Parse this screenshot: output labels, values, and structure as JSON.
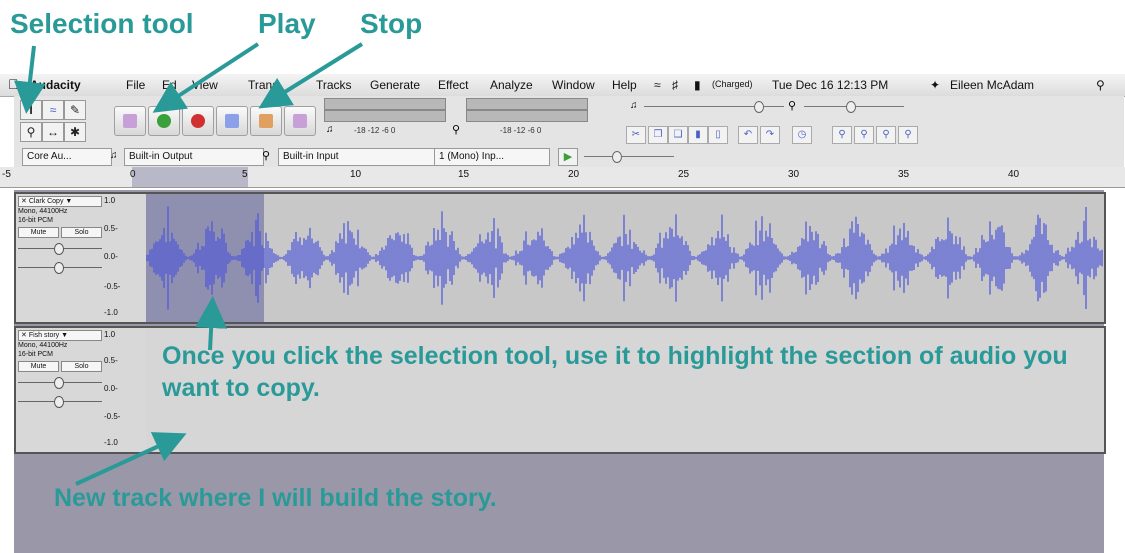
{
  "annotations": {
    "selection_tool": "Selection tool",
    "play": "Play",
    "stop": "Stop",
    "instruction": "Once you click the selection tool, use it to highlight the section of audio you want to copy.",
    "new_track": "New track where I will build the story."
  },
  "menubar": {
    "app": "Audacity",
    "items": [
      "File",
      "Ed",
      "View",
      "Trans",
      "Tracks",
      "Generate",
      "Effect",
      "Analyze",
      "Window",
      "Help"
    ],
    "battery": "(Charged)",
    "clock": "Tue Dec 16  12:13 PM",
    "user": "Eileen McAdam"
  },
  "device_bar": {
    "host": "Core Au...",
    "output": "Built-in Output",
    "input": "Built-in Input",
    "channels": "1 (Mono) Inp..."
  },
  "meters": {
    "scale_play": "-18  -12  -6  0",
    "scale_rec": "-18  -12  -6  0"
  },
  "timeline": {
    "ticks": [
      "-5",
      "0",
      "5",
      "10",
      "15",
      "20",
      "25",
      "30",
      "35",
      "40"
    ]
  },
  "tracks": [
    {
      "name": "Clark Copy",
      "info1": "Mono, 44100Hz",
      "info2": "16-bit PCM",
      "mute": "Mute",
      "solo": "Solo",
      "scale": [
        "1.0",
        "0.5-",
        "0.0-",
        "-0.5-",
        "-1.0"
      ]
    },
    {
      "name": "Fish story",
      "info1": "Mono, 44100Hz",
      "info2": "16-bit PCM",
      "mute": "Mute",
      "solo": "Solo",
      "scale": [
        "1.0",
        "0.5-",
        "0.0-",
        "-0.5-",
        "-1.0"
      ]
    }
  ],
  "colors": {
    "callout": "#2a9a98",
    "waveform": "#4b55d8",
    "selection": "#8f8fb0",
    "track_bg": "#d8d8d8",
    "empty_area": "#9a98a8"
  }
}
